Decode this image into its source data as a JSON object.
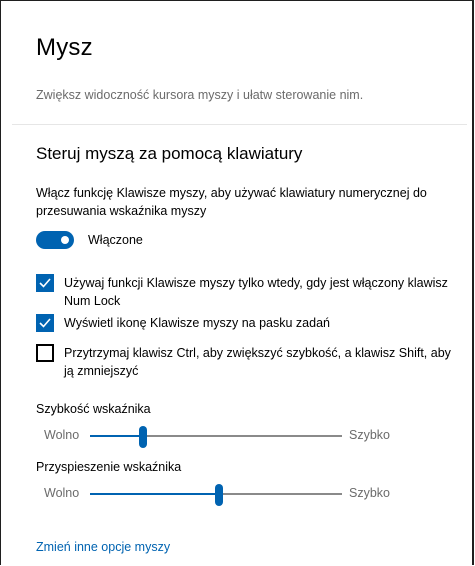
{
  "page": {
    "title": "Mysz",
    "subtitle": "Zwiększ widoczność kursora myszy i ułatw sterowanie nim."
  },
  "keyboard_section": {
    "heading": "Steruj myszą za pomocą klawiatury",
    "description": "Włącz funkcję Klawisze myszy, aby używać klawiatury numerycznej do przesuwania wskaźnika myszy",
    "toggle": {
      "state": "on",
      "label": "Włączone"
    },
    "options": [
      {
        "label": "Używaj funkcji Klawisze myszy tylko wtedy, gdy jest włączony klawisz Num Lock",
        "checked": true
      },
      {
        "label": "Wyświetl ikonę Klawisze myszy na pasku zadań",
        "checked": true
      },
      {
        "label": "Przytrzymaj klawisz Ctrl, aby zwiększyć szybkość, a klawisz Shift, aby ją zmniejszyć",
        "checked": false
      }
    ]
  },
  "sliders": [
    {
      "label": "Szybkość wskaźnika",
      "min_label": "Wolno",
      "max_label": "Szybko",
      "value_fraction": 0.21
    },
    {
      "label": "Przyspieszenie wskaźnika",
      "min_label": "Wolno",
      "max_label": "Szybko",
      "value_fraction": 0.51
    }
  ],
  "footer": {
    "link": "Zmień inne opcje myszy"
  },
  "colors": {
    "accent": "#0063b1",
    "secondary_text": "#6b6b6b",
    "track": "#8a8a8a"
  },
  "icons": {
    "checkbox_checked": "checkmark-icon"
  }
}
